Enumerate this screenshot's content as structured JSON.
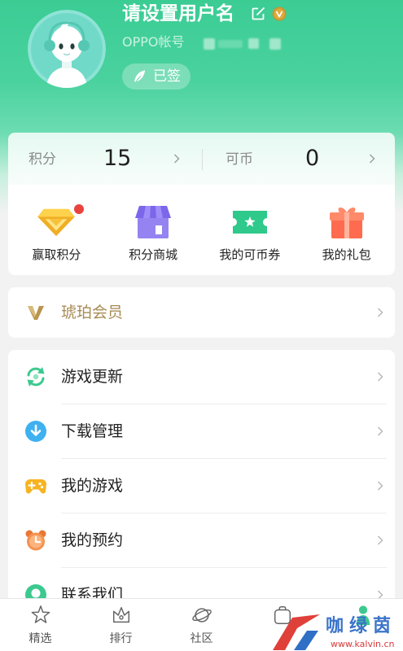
{
  "profile": {
    "username": "请设置用户名",
    "account_label": "OPPO帐号",
    "sign_label": "已签",
    "avatar_icon": "avatar-cartoon-icon",
    "edit_icon": "edit-icon",
    "badge_icon": "vip-v-badge-icon",
    "sign_icon": "feather-icon"
  },
  "wallet": {
    "points_label": "积分",
    "points_value": "15",
    "coins_label": "可币",
    "coins_value": "0"
  },
  "shortcuts": [
    {
      "label": "赢取积分",
      "icon": "diamond-icon",
      "notification_dot": true
    },
    {
      "label": "积分商城",
      "icon": "store-icon"
    },
    {
      "label": "我的可币券",
      "icon": "ticket-icon"
    },
    {
      "label": "我的礼包",
      "icon": "gift-icon"
    }
  ],
  "membership": {
    "label": "琥珀会员",
    "icon": "amber-v-icon"
  },
  "menu": [
    {
      "label": "游戏更新",
      "icon": "refresh-icon"
    },
    {
      "label": "下载管理",
      "icon": "download-icon"
    },
    {
      "label": "我的游戏",
      "icon": "gamepad-icon"
    },
    {
      "label": "我的预约",
      "icon": "alarm-clock-icon"
    },
    {
      "label": "联系我们",
      "icon": "contact-icon"
    }
  ],
  "tabbar": [
    {
      "label": "精选",
      "icon": "star-icon"
    },
    {
      "label": "排行",
      "icon": "crown-icon"
    },
    {
      "label": "社区",
      "icon": "planet-icon"
    },
    {
      "icon": "bag-icon"
    },
    {
      "icon": "person-icon",
      "active": true
    }
  ],
  "watermark": {
    "name": "咖绿茵",
    "url": "www.kalvin.cn"
  },
  "colors": {
    "header_green": "#3bcc94",
    "amber_gold": "#a88b55",
    "notification_red": "#e8433d",
    "active_tab_green": "#3cc98f",
    "page_background": "#f2f2f2"
  }
}
